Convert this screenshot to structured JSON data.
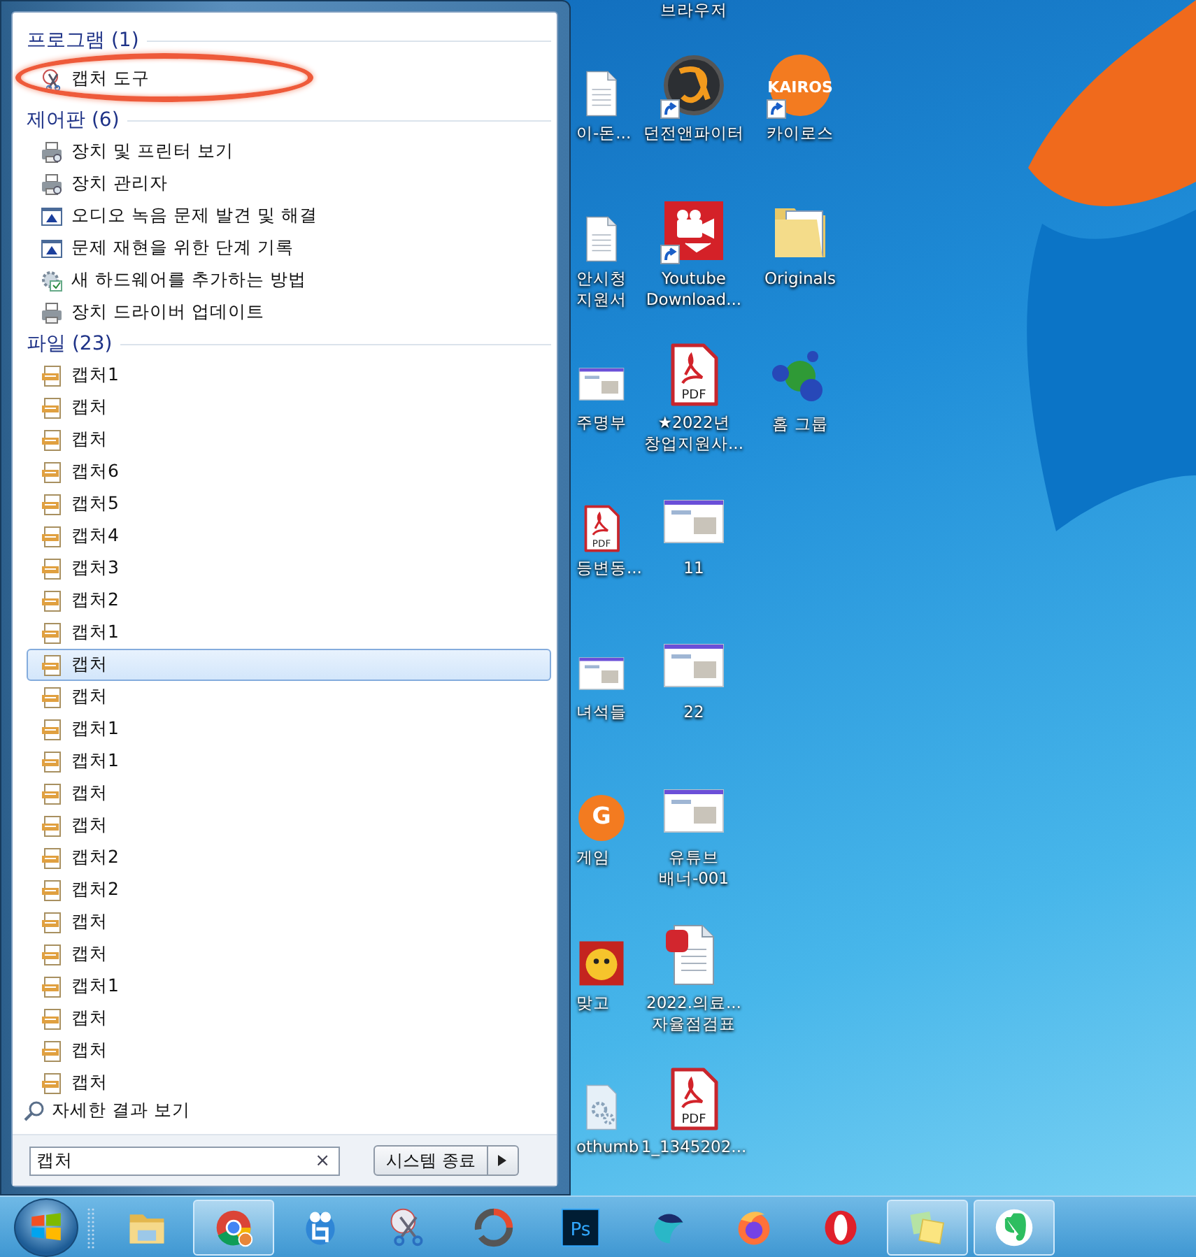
{
  "desktop": {
    "top_label": "브라우저",
    "columns": [
      {
        "items": [
          {
            "kind": "document",
            "label": "이-돈...",
            "shortcut": false
          },
          {
            "kind": "document",
            "label": "안시청\n지원서",
            "shortcut": false
          },
          {
            "kind": "thumbnail",
            "label": "주명부",
            "shortcut": false
          },
          {
            "kind": "pdf",
            "icon_text": "PDF",
            "label": "등변동...",
            "shortcut": false
          },
          {
            "kind": "thumbnail",
            "label": "녀석들",
            "shortcut": false
          },
          {
            "kind": "logo",
            "icon_text": "G",
            "label": "게임",
            "shortcut": false
          },
          {
            "kind": "cartoon",
            "label": "맞고",
            "shortcut": false
          },
          {
            "kind": "settings",
            "label": "othumb",
            "shortcut": false
          }
        ]
      },
      {
        "items": [
          {
            "kind": "emblem",
            "label": "던전앤파이터",
            "shortcut": true
          },
          {
            "kind": "video",
            "label": "Youtube\nDownload...",
            "shortcut": true
          },
          {
            "kind": "pdf",
            "icon_text": "PDF",
            "label": "★2022년\n창업지원사...",
            "shortcut": false
          },
          {
            "kind": "thumbnail",
            "label": "11",
            "shortcut": false
          },
          {
            "kind": "thumbnail",
            "label": "22",
            "shortcut": false
          },
          {
            "kind": "thumbnail",
            "label": "유튜브\n배너-001",
            "shortcut": false
          },
          {
            "kind": "hwp",
            "label": "2022.의료...\n자율점검표",
            "shortcut": false
          },
          {
            "kind": "pdf",
            "icon_text": "PDF",
            "label": "1_1345202...",
            "shortcut": false
          }
        ]
      },
      {
        "items": [
          {
            "kind": "logo",
            "icon_text": "KAIROS",
            "label": "카이로스",
            "shortcut": true
          },
          {
            "kind": "folder",
            "label": "Originals",
            "shortcut": false
          },
          {
            "kind": "spheres",
            "label": "홈 그룹",
            "shortcut": false
          }
        ]
      }
    ]
  },
  "start_menu": {
    "sections": [
      {
        "title": "프로그램 (1)",
        "items": [
          {
            "kind": "snip",
            "label": "캡처 도구",
            "selected": false,
            "circled": true
          }
        ]
      },
      {
        "title": "제어판 (6)",
        "items": [
          {
            "kind": "printer",
            "label": "장치 및 프린터 보기",
            "selected": false
          },
          {
            "kind": "printer",
            "label": "장치 관리자",
            "selected": false
          },
          {
            "kind": "monitor",
            "label": "오디오 녹음 문제 발견 및 해결",
            "selected": false
          },
          {
            "kind": "monitor",
            "label": "문제 재현을 위한 단계 기록",
            "selected": false
          },
          {
            "kind": "gear",
            "label": "새 하드웨어를 추가하는 방법",
            "selected": false
          },
          {
            "kind": "driver",
            "label": "장치 드라이버 업데이트",
            "selected": false
          }
        ]
      },
      {
        "title": "파일 (23)",
        "items": [
          {
            "kind": "jpg",
            "label": "캡처1",
            "selected": false
          },
          {
            "kind": "jpg",
            "label": "캡처",
            "selected": false
          },
          {
            "kind": "jpg",
            "label": "캡처",
            "selected": false
          },
          {
            "kind": "jpg",
            "label": "캡처6",
            "selected": false
          },
          {
            "kind": "jpg",
            "label": "캡처5",
            "selected": false
          },
          {
            "kind": "jpg",
            "label": "캡처4",
            "selected": false
          },
          {
            "kind": "jpg",
            "label": "캡처3",
            "selected": false
          },
          {
            "kind": "jpg",
            "label": "캡처2",
            "selected": false
          },
          {
            "kind": "jpg",
            "label": "캡처1",
            "selected": false
          },
          {
            "kind": "jpg",
            "label": "캡처",
            "selected": true
          },
          {
            "kind": "jpg",
            "label": "캡처",
            "selected": false
          },
          {
            "kind": "jpg",
            "label": "캡처1",
            "selected": false
          },
          {
            "kind": "jpg",
            "label": "캡처1",
            "selected": false
          },
          {
            "kind": "jpg",
            "label": "캡처",
            "selected": false
          },
          {
            "kind": "jpg",
            "label": "캡처",
            "selected": false
          },
          {
            "kind": "jpg",
            "label": "캡처2",
            "selected": false
          },
          {
            "kind": "jpg",
            "label": "캡처2",
            "selected": false
          },
          {
            "kind": "jpg",
            "label": "캡처",
            "selected": false
          },
          {
            "kind": "jpg",
            "label": "캡처",
            "selected": false
          },
          {
            "kind": "jpg",
            "label": "캡처1",
            "selected": false
          },
          {
            "kind": "jpg",
            "label": "캡처",
            "selected": false
          },
          {
            "kind": "jpg",
            "label": "캡처",
            "selected": false
          },
          {
            "kind": "jpg",
            "label": "캡처",
            "selected": false
          }
        ]
      }
    ],
    "more_results": "자세한 결과 보기",
    "search": {
      "value": "캡처",
      "clear": "×"
    },
    "shutdown": "시스템 종료"
  },
  "taskbar": [
    {
      "kind": "folder",
      "running": false
    },
    {
      "kind": "chrome",
      "running": true
    },
    {
      "kind": "crop",
      "running": false
    },
    {
      "kind": "snip",
      "running": false
    },
    {
      "kind": "ring",
      "running": false
    },
    {
      "kind": "ps",
      "icon_text": "Ps",
      "running": false
    },
    {
      "kind": "whale",
      "running": false
    },
    {
      "kind": "firefox",
      "running": false
    },
    {
      "kind": "opera",
      "running": false
    },
    {
      "kind": "notes",
      "running": true
    },
    {
      "kind": "evernote",
      "running": true
    }
  ]
}
